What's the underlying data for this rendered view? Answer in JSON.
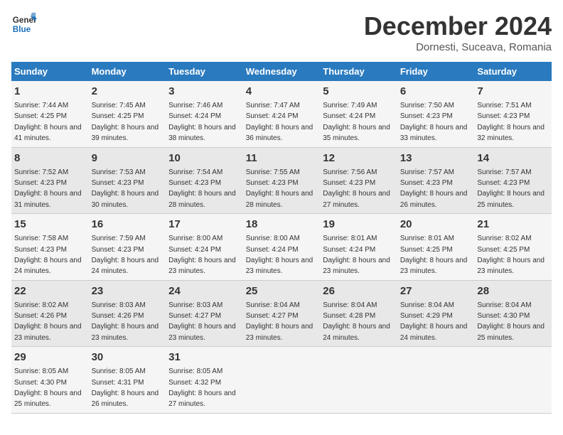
{
  "logo": {
    "line1": "General",
    "line2": "Blue"
  },
  "title": "December 2024",
  "location": "Dornesti, Suceava, Romania",
  "weekdays": [
    "Sunday",
    "Monday",
    "Tuesday",
    "Wednesday",
    "Thursday",
    "Friday",
    "Saturday"
  ],
  "weeks": [
    [
      {
        "day": "1",
        "sunrise": "7:44 AM",
        "sunset": "4:25 PM",
        "daylight": "8 hours and 41 minutes."
      },
      {
        "day": "2",
        "sunrise": "7:45 AM",
        "sunset": "4:25 PM",
        "daylight": "8 hours and 39 minutes."
      },
      {
        "day": "3",
        "sunrise": "7:46 AM",
        "sunset": "4:24 PM",
        "daylight": "8 hours and 38 minutes."
      },
      {
        "day": "4",
        "sunrise": "7:47 AM",
        "sunset": "4:24 PM",
        "daylight": "8 hours and 36 minutes."
      },
      {
        "day": "5",
        "sunrise": "7:49 AM",
        "sunset": "4:24 PM",
        "daylight": "8 hours and 35 minutes."
      },
      {
        "day": "6",
        "sunrise": "7:50 AM",
        "sunset": "4:23 PM",
        "daylight": "8 hours and 33 minutes."
      },
      {
        "day": "7",
        "sunrise": "7:51 AM",
        "sunset": "4:23 PM",
        "daylight": "8 hours and 32 minutes."
      }
    ],
    [
      {
        "day": "8",
        "sunrise": "7:52 AM",
        "sunset": "4:23 PM",
        "daylight": "8 hours and 31 minutes."
      },
      {
        "day": "9",
        "sunrise": "7:53 AM",
        "sunset": "4:23 PM",
        "daylight": "8 hours and 30 minutes."
      },
      {
        "day": "10",
        "sunrise": "7:54 AM",
        "sunset": "4:23 PM",
        "daylight": "8 hours and 28 minutes."
      },
      {
        "day": "11",
        "sunrise": "7:55 AM",
        "sunset": "4:23 PM",
        "daylight": "8 hours and 28 minutes."
      },
      {
        "day": "12",
        "sunrise": "7:56 AM",
        "sunset": "4:23 PM",
        "daylight": "8 hours and 27 minutes."
      },
      {
        "day": "13",
        "sunrise": "7:57 AM",
        "sunset": "4:23 PM",
        "daylight": "8 hours and 26 minutes."
      },
      {
        "day": "14",
        "sunrise": "7:57 AM",
        "sunset": "4:23 PM",
        "daylight": "8 hours and 25 minutes."
      }
    ],
    [
      {
        "day": "15",
        "sunrise": "7:58 AM",
        "sunset": "4:23 PM",
        "daylight": "8 hours and 24 minutes."
      },
      {
        "day": "16",
        "sunrise": "7:59 AM",
        "sunset": "4:23 PM",
        "daylight": "8 hours and 24 minutes."
      },
      {
        "day": "17",
        "sunrise": "8:00 AM",
        "sunset": "4:24 PM",
        "daylight": "8 hours and 23 minutes."
      },
      {
        "day": "18",
        "sunrise": "8:00 AM",
        "sunset": "4:24 PM",
        "daylight": "8 hours and 23 minutes."
      },
      {
        "day": "19",
        "sunrise": "8:01 AM",
        "sunset": "4:24 PM",
        "daylight": "8 hours and 23 minutes."
      },
      {
        "day": "20",
        "sunrise": "8:01 AM",
        "sunset": "4:25 PM",
        "daylight": "8 hours and 23 minutes."
      },
      {
        "day": "21",
        "sunrise": "8:02 AM",
        "sunset": "4:25 PM",
        "daylight": "8 hours and 23 minutes."
      }
    ],
    [
      {
        "day": "22",
        "sunrise": "8:02 AM",
        "sunset": "4:26 PM",
        "daylight": "8 hours and 23 minutes."
      },
      {
        "day": "23",
        "sunrise": "8:03 AM",
        "sunset": "4:26 PM",
        "daylight": "8 hours and 23 minutes."
      },
      {
        "day": "24",
        "sunrise": "8:03 AM",
        "sunset": "4:27 PM",
        "daylight": "8 hours and 23 minutes."
      },
      {
        "day": "25",
        "sunrise": "8:04 AM",
        "sunset": "4:27 PM",
        "daylight": "8 hours and 23 minutes."
      },
      {
        "day": "26",
        "sunrise": "8:04 AM",
        "sunset": "4:28 PM",
        "daylight": "8 hours and 24 minutes."
      },
      {
        "day": "27",
        "sunrise": "8:04 AM",
        "sunset": "4:29 PM",
        "daylight": "8 hours and 24 minutes."
      },
      {
        "day": "28",
        "sunrise": "8:04 AM",
        "sunset": "4:30 PM",
        "daylight": "8 hours and 25 minutes."
      }
    ],
    [
      {
        "day": "29",
        "sunrise": "8:05 AM",
        "sunset": "4:30 PM",
        "daylight": "8 hours and 25 minutes."
      },
      {
        "day": "30",
        "sunrise": "8:05 AM",
        "sunset": "4:31 PM",
        "daylight": "8 hours and 26 minutes."
      },
      {
        "day": "31",
        "sunrise": "8:05 AM",
        "sunset": "4:32 PM",
        "daylight": "8 hours and 27 minutes."
      },
      null,
      null,
      null,
      null
    ]
  ]
}
